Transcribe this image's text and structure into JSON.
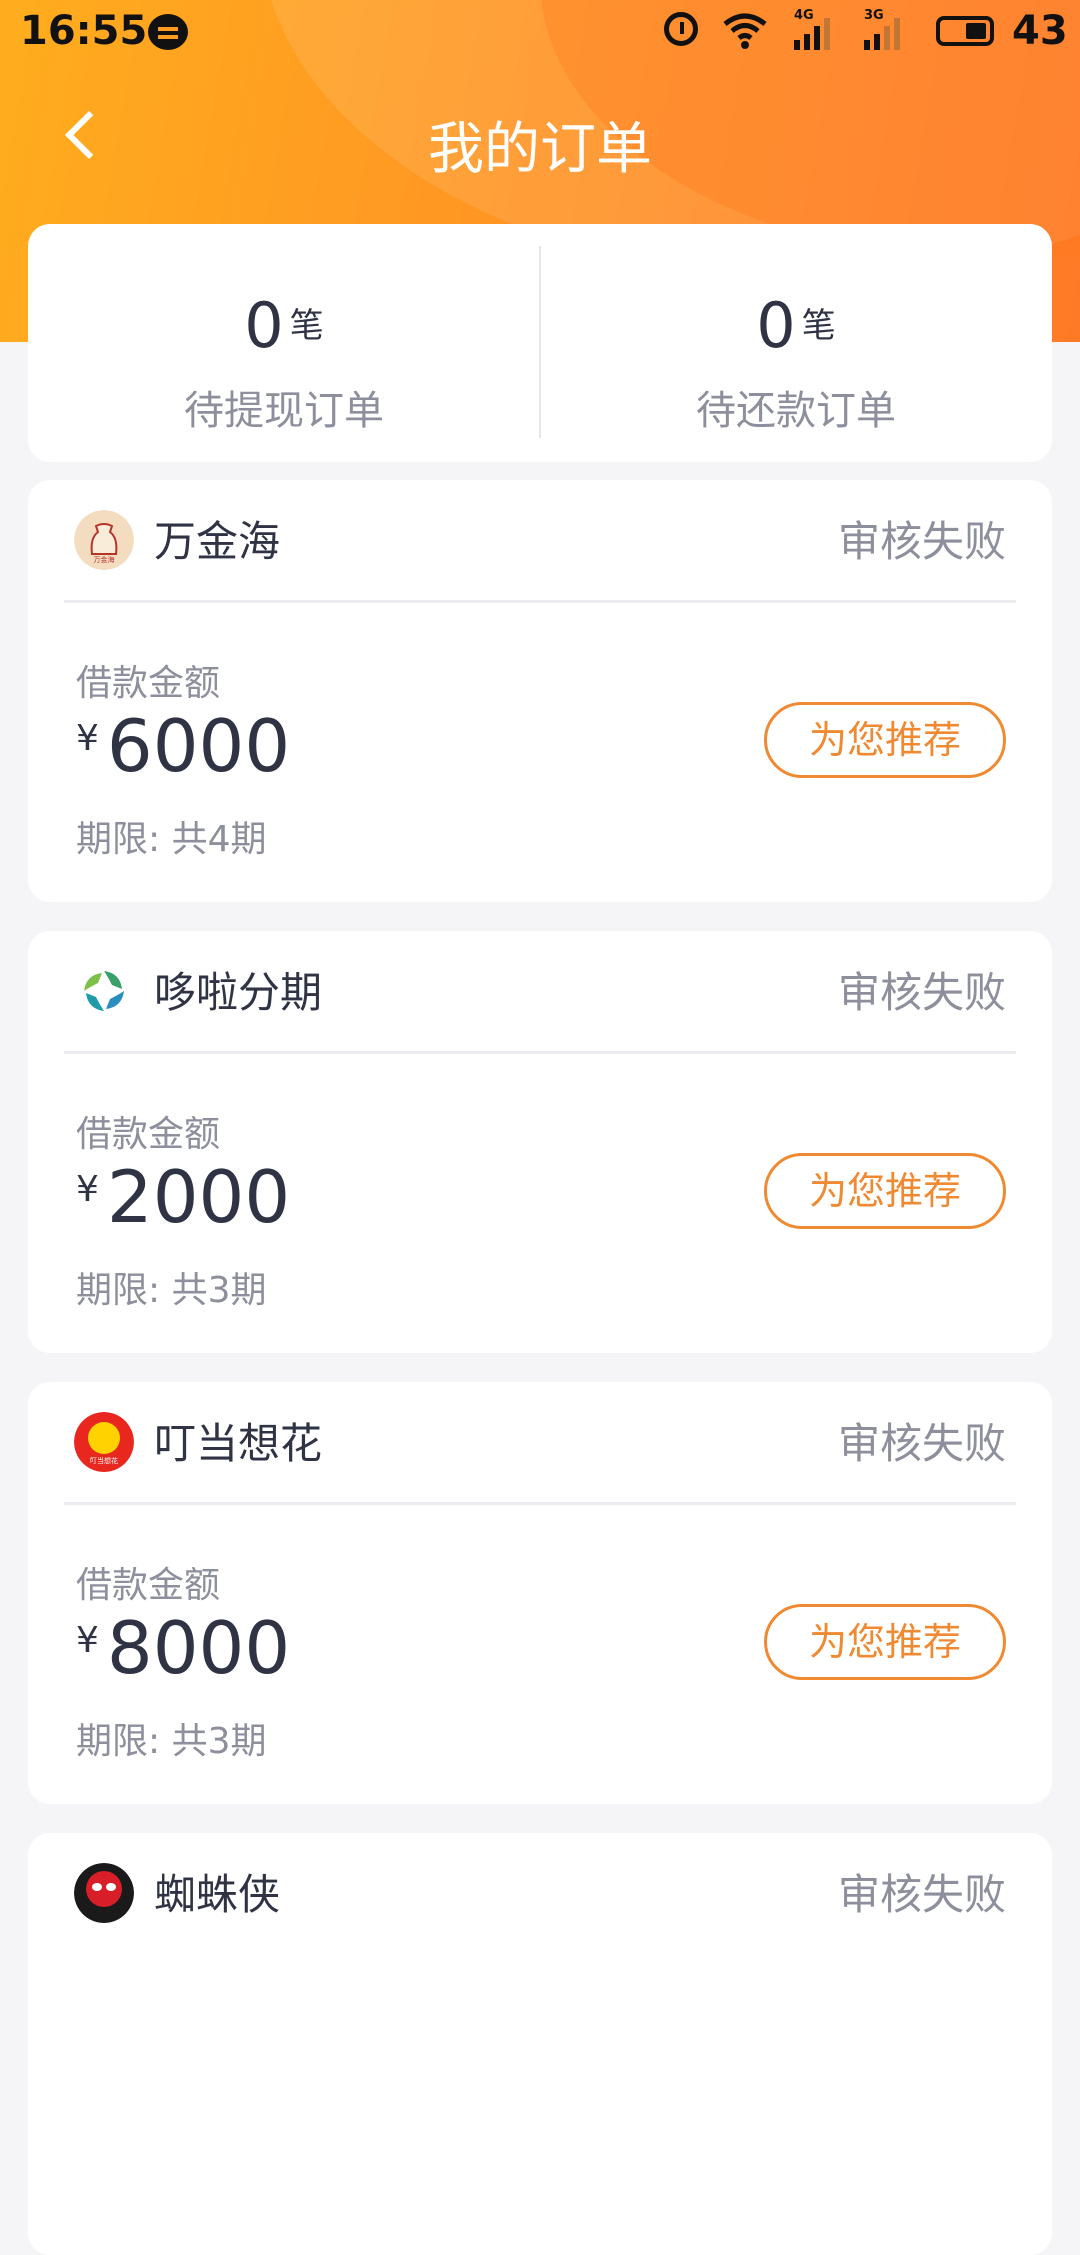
{
  "status_bar": {
    "time": "16:55",
    "net1": "4G",
    "net2": "3G",
    "battery": "43",
    "icons": [
      "chat-bubble-icon",
      "alarm-icon",
      "wifi-icon",
      "signal-icon",
      "signal-icon",
      "battery-icon"
    ]
  },
  "header": {
    "title": "我的订单",
    "back_icon": "back-arrow-icon",
    "gradient_colors": [
      "#ffad1e",
      "#ff7a26"
    ]
  },
  "summary": {
    "withdraw": {
      "count": "0",
      "unit": "笔",
      "label": "待提现订单"
    },
    "repay": {
      "count": "0",
      "unit": "笔",
      "label": "待还款订单"
    }
  },
  "orders": [
    {
      "name": "万金海",
      "status": "审核失败",
      "amount_label": "借款金额",
      "currency": "¥",
      "amount": "6000",
      "term": "期限: 共4期",
      "button": "为您推荐",
      "logo": "money-bag-logo"
    },
    {
      "name": "哆啦分期",
      "status": "审核失败",
      "amount_label": "借款金额",
      "currency": "¥",
      "amount": "2000",
      "term": "期限: 共3期",
      "button": "为您推荐",
      "logo": "spiral-logo"
    },
    {
      "name": "叮当想花",
      "status": "审核失败",
      "amount_label": "借款金额",
      "currency": "¥",
      "amount": "8000",
      "term": "期限: 共3期",
      "button": "为您推荐",
      "logo": "bell-logo"
    },
    {
      "name": "蜘蛛侠",
      "status": "审核失败",
      "logo": "spiderman-logo"
    }
  ],
  "colors": {
    "accent": "#f08a32",
    "text_dark": "#2f3344",
    "text_muted": "#8d8f9c",
    "background": "#f5f5f7"
  }
}
